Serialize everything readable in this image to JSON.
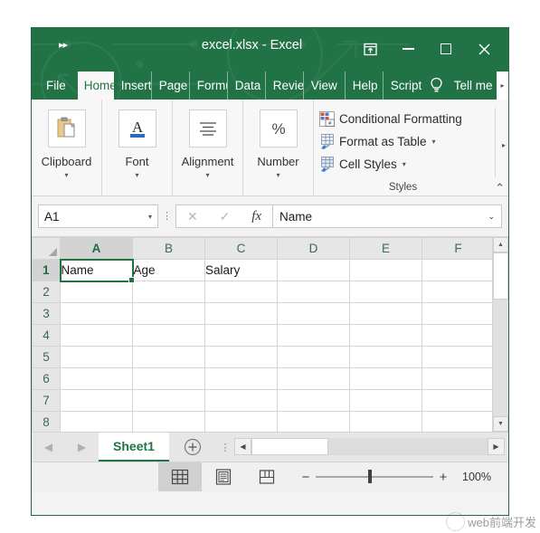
{
  "window": {
    "title": "excel.xlsx  -  Excel",
    "quick_access": "▸▸",
    "buttons": {
      "ribbon_display_options": "ribbon-display-options",
      "minimize": "—",
      "maximize": "□",
      "close": "✕"
    }
  },
  "ribbon_tabs": [
    {
      "label": "File",
      "active": false
    },
    {
      "label": "Home",
      "active": true
    },
    {
      "label": "Insert",
      "active": false
    },
    {
      "label": "Page Layout",
      "active": false
    },
    {
      "label": "Formulas",
      "active": false
    },
    {
      "label": "Data",
      "active": false
    },
    {
      "label": "Review",
      "active": false
    },
    {
      "label": "View",
      "active": false
    },
    {
      "label": "Help",
      "active": false
    },
    {
      "label": "Script Lab",
      "active": false
    }
  ],
  "tell_me": {
    "label": "Tell me what you want to do",
    "bulb_icon": "lightbulb-icon",
    "overflow": "▸"
  },
  "ribbon": {
    "groups": [
      {
        "label": "Clipboard",
        "icon": "clipboard-icon",
        "caret": "▾"
      },
      {
        "label": "Font",
        "icon": "font-icon",
        "caret": "▾"
      },
      {
        "label": "Alignment",
        "icon": "alignment-icon",
        "caret": "▾"
      },
      {
        "label": "Number",
        "icon": "percent-icon",
        "caret": "▾"
      }
    ],
    "styles": {
      "group_label": "Styles",
      "items": [
        {
          "label": "Conditional Formatting",
          "icon": "conditional-formatting-icon",
          "caret": ""
        },
        {
          "label": "Format as Table",
          "icon": "format-as-table-icon",
          "caret": "▾"
        },
        {
          "label": "Cell Styles",
          "icon": "cell-styles-icon",
          "caret": "▾"
        }
      ],
      "expand_arrow": "▸"
    },
    "collapse_icon": "⌃"
  },
  "formula_bar": {
    "name_box_value": "A1",
    "name_box_caret": "▾",
    "cancel_icon": "✕",
    "enter_icon": "✓",
    "function_icon": "fx",
    "formula_value": "Name",
    "formula_caret": "⌄"
  },
  "grid": {
    "columns": [
      "A",
      "B",
      "C",
      "D",
      "E",
      "F"
    ],
    "selected_column": "A",
    "rows": [
      "1",
      "2",
      "3",
      "4",
      "5",
      "6",
      "7",
      "8"
    ],
    "selected_row": "1",
    "active_cell": "A1",
    "cells": [
      [
        "Name",
        "Age",
        "Salary",
        "",
        "",
        ""
      ],
      [
        "",
        "",
        "",
        "",
        "",
        ""
      ],
      [
        "",
        "",
        "",
        "",
        "",
        ""
      ],
      [
        "",
        "",
        "",
        "",
        "",
        ""
      ],
      [
        "",
        "",
        "",
        "",
        "",
        ""
      ],
      [
        "",
        "",
        "",
        "",
        "",
        ""
      ],
      [
        "",
        "",
        "",
        "",
        "",
        ""
      ],
      [
        "",
        "",
        "",
        "",
        "",
        ""
      ]
    ]
  },
  "scrollbars": {
    "v_up": "▲",
    "v_down": "▼",
    "h_left": "◀",
    "h_right": "▶"
  },
  "sheet_bar": {
    "nav_prev": "◀",
    "nav_next": "▶",
    "tabs": [
      {
        "label": "Sheet1",
        "active": true
      }
    ],
    "add_sheet_icon": "plus-circle-icon",
    "overflow_dots": "⋮"
  },
  "status_bar": {
    "views": [
      {
        "name": "normal-view",
        "icon": "grid-view-icon",
        "selected": true
      },
      {
        "name": "page-layout-view",
        "icon": "page-layout-icon",
        "selected": false
      },
      {
        "name": "page-break-view",
        "icon": "page-break-icon",
        "selected": false
      }
    ],
    "zoom_out": "−",
    "zoom_in": "+",
    "zoom_level": "100%"
  },
  "watermark": {
    "text": "web前端开发",
    "logo": "wechat-qr-icon"
  },
  "colors": {
    "excel_green": "#217346",
    "tab_active_bg": "#f7f7f7",
    "ribbon_bg": "#f7f7f7",
    "grid_line": "#d4d4d4",
    "header_bg": "#e6e6e6",
    "header_selected_bg": "#d3d3d3"
  }
}
